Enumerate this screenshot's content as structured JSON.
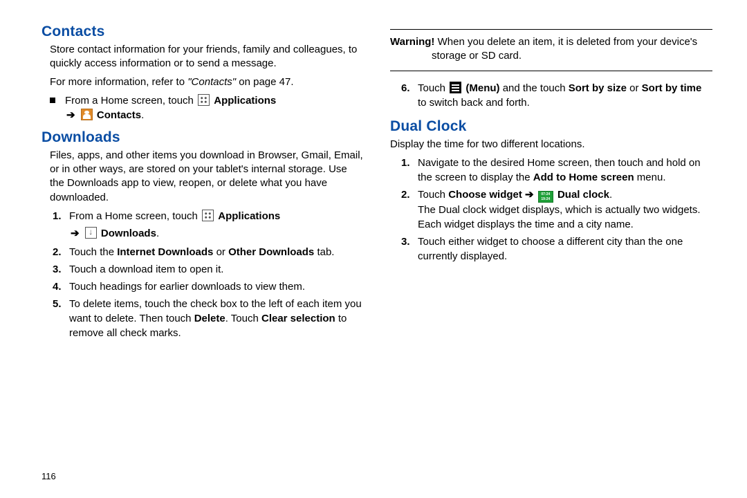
{
  "page_number": "116",
  "left": {
    "contacts": {
      "heading": "Contacts",
      "p1": "Store contact information for your friends, family and colleagues, to quickly access information or to send a message.",
      "ref_prefix": "For more information, refer to ",
      "ref_italic": "\"Contacts\"",
      "ref_suffix": "  on page 47.",
      "bullet_lead": "From a Home screen, touch ",
      "bullet_apps": "Applications",
      "bullet_arrow": "➔",
      "bullet_target": "Contacts",
      "bullet_period": "."
    },
    "downloads": {
      "heading": "Downloads",
      "intro": "Files, apps, and other items you download in Browser, Gmail, Email, or in other ways, are stored on your tablet's internal storage. Use the Downloads app to view, reopen, or delete what you have downloaded.",
      "step1_lead": "From a Home screen, touch ",
      "step1_apps": "Applications",
      "step1_arrow": "➔",
      "step1_target": "Downloads",
      "step1_period": ".",
      "step2_a": "Touch the ",
      "step2_b": "Internet Downloads",
      "step2_c": " or ",
      "step2_d": "Other Downloads",
      "step2_e": " tab.",
      "step3": "Touch a download item to open it.",
      "step4": "Touch headings for earlier downloads to view them.",
      "step5_a": "To delete items, touch the check box to the left of each item you want to delete. Then touch ",
      "step5_b": "Delete",
      "step5_c": ". Touch ",
      "step5_d": "Clear selection",
      "step5_e": " to remove all check marks."
    }
  },
  "right": {
    "warning_label": "Warning!",
    "warning_text": " When you delete an item, it is deleted from your device's storage or SD card.",
    "step6_a": "Touch ",
    "step6_menu": "(Menu)",
    "step6_b": " and the touch ",
    "step6_c": "Sort by size",
    "step6_d": " or ",
    "step6_e": "Sort by time",
    "step6_f": " to switch back and forth.",
    "dual": {
      "heading": "Dual Clock",
      "intro": "Display the time for two different locations.",
      "s1_a": "Navigate to the desired Home screen, then touch and hold on the screen to display the ",
      "s1_b": "Add to Home screen",
      "s1_c": " menu.",
      "s2_a": "Touch ",
      "s2_b": "Choose widget",
      "s2_arrow": " ➔ ",
      "s2_icon_top": "07:24",
      "s2_icon_bot": "19:24",
      "s2_target": "Dual clock",
      "s2_period": ".",
      "s2_desc": "The Dual clock widget displays, which is actually two widgets. Each widget displays the time and a city name.",
      "s3": "Touch either widget to choose a different city than the one currently displayed."
    }
  }
}
